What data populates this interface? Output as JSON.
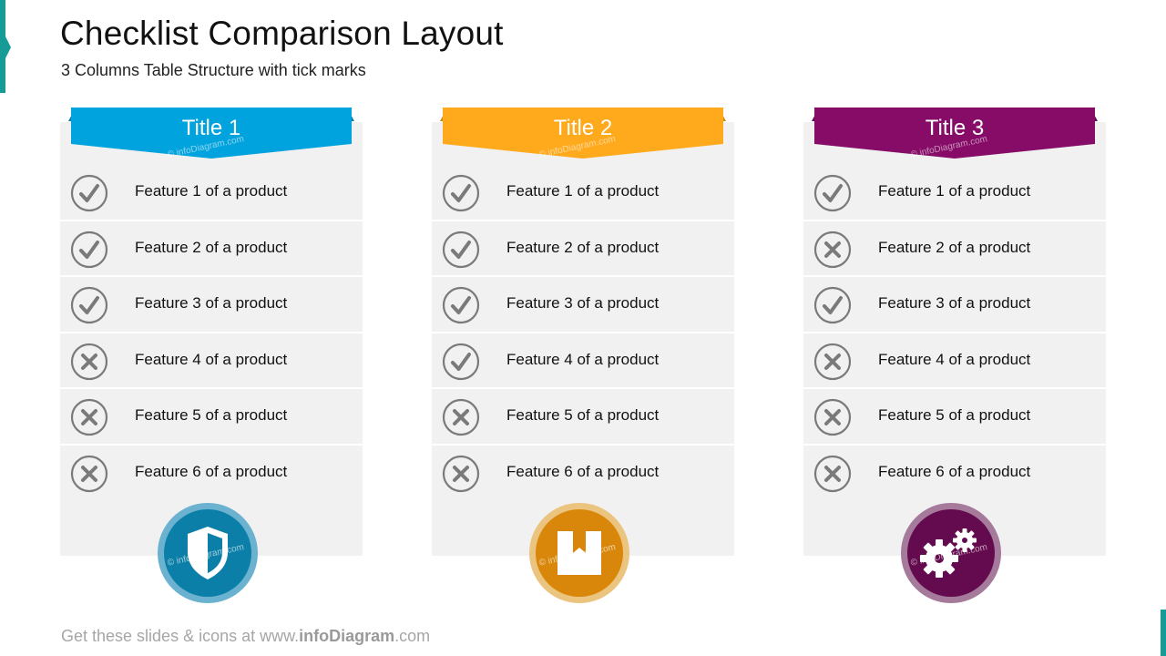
{
  "header": {
    "title": "Checklist Comparison Layout",
    "subtitle": "3 Columns Table Structure with tick marks"
  },
  "colors": {
    "accent_teal": "#169b96",
    "column_1": "#00a3dd",
    "column_1_dark": "#0b7fa8",
    "column_2": "#ffa91c",
    "column_2_dark": "#d9870b",
    "column_3": "#860c68",
    "column_3_dark": "#640a4e",
    "panel_bg": "#f1f1f1",
    "mark_gray": "#7a7a7a"
  },
  "watermark": "© infoDiagram.com",
  "columns": [
    {
      "title": "Title 1",
      "icon": "shield-icon",
      "features": [
        {
          "label": "Feature 1 of a product",
          "status": "check"
        },
        {
          "label": "Feature 2 of a product",
          "status": "check"
        },
        {
          "label": "Feature 3 of a product",
          "status": "check"
        },
        {
          "label": "Feature 4 of a product",
          "status": "cross"
        },
        {
          "label": "Feature 5 of a product",
          "status": "cross"
        },
        {
          "label": "Feature 6 of a product",
          "status": "cross"
        }
      ]
    },
    {
      "title": "Title 2",
      "icon": "bookmark-box-icon",
      "features": [
        {
          "label": "Feature 1 of a product",
          "status": "check"
        },
        {
          "label": "Feature 2 of a product",
          "status": "check"
        },
        {
          "label": "Feature 3 of a product",
          "status": "check"
        },
        {
          "label": "Feature 4 of a product",
          "status": "check"
        },
        {
          "label": "Feature 5 of a product",
          "status": "cross"
        },
        {
          "label": "Feature 6 of a product",
          "status": "cross"
        }
      ]
    },
    {
      "title": "Title 3",
      "icon": "gears-icon",
      "features": [
        {
          "label": "Feature 1 of a product",
          "status": "check"
        },
        {
          "label": "Feature 2 of a product",
          "status": "cross"
        },
        {
          "label": "Feature 3 of a product",
          "status": "check"
        },
        {
          "label": "Feature 4 of a product",
          "status": "cross"
        },
        {
          "label": "Feature 5 of a product",
          "status": "cross"
        },
        {
          "label": "Feature 6 of a product",
          "status": "cross"
        }
      ]
    }
  ],
  "footer": {
    "prefix": "Get these slides & icons at www.",
    "brand": "infoDiagram",
    "suffix": ".com"
  }
}
